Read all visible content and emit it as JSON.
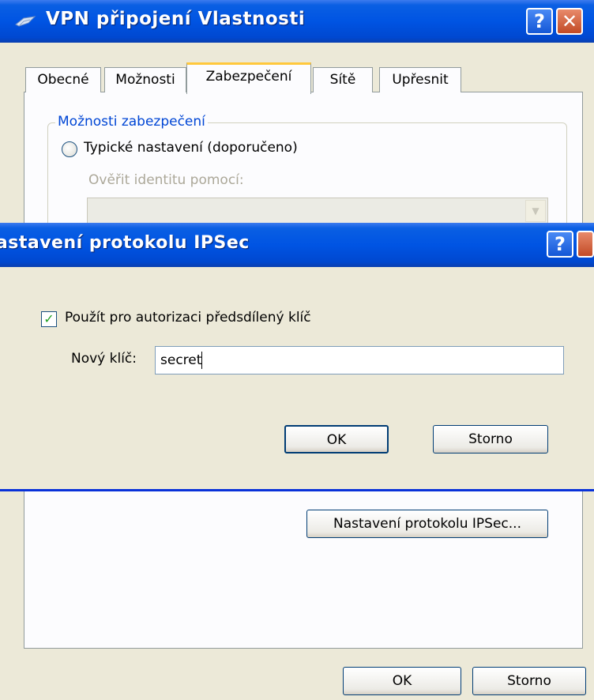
{
  "back_window": {
    "title": "VPN připojení Vlastnosti",
    "help_glyph": "?",
    "close_glyph": "✕",
    "tabs": [
      {
        "label": "Obecné"
      },
      {
        "label": "Možnosti"
      },
      {
        "label": "Zabezpečení"
      },
      {
        "label": "Sítě"
      },
      {
        "label": "Upřesnit"
      }
    ],
    "selected_tab": "Zabezpečení",
    "group_title": "Možnosti zabezpečení",
    "typical_radio_label": "Typické nastavení (doporučeno)",
    "verify_label": "Ověřit identitu pomocí:",
    "verify_value": "",
    "ipsec_button_label": "Nastavení protokolu IPSec...",
    "ok_label": "OK",
    "cancel_label": "Storno"
  },
  "dialog": {
    "title": "Nastavení protokolu IPSec",
    "help_glyph": "?",
    "checkbox_label": "Použít pro autorizaci předsdílený klíč",
    "checkbox_checked": true,
    "key_label": "Nový klíč:",
    "key_value": "secret",
    "ok_label": "OK",
    "cancel_label": "Storno"
  },
  "colors": {
    "titlebar_blue": "#0054e3",
    "face": "#ece9d8",
    "accent_tab": "#ffc83c",
    "group_title": "#0046d5",
    "check_green": "#21a121"
  }
}
